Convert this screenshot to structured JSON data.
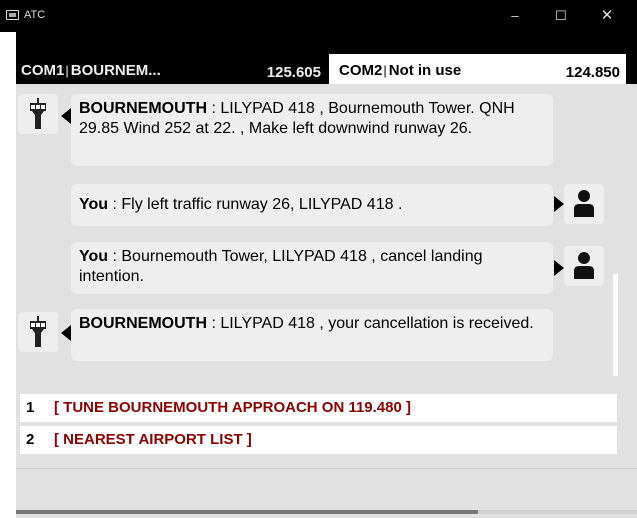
{
  "window": {
    "title": "ATC",
    "minimize_glyph": "–",
    "maximize_glyph": "☐",
    "close_glyph": "✕"
  },
  "radios": {
    "com1": {
      "label": "COM1",
      "station": "BOURNEM...",
      "frequency": "125.605"
    },
    "com2": {
      "label": "COM2",
      "station": "Not in use",
      "frequency": "124.850"
    }
  },
  "messages": [
    {
      "speaker": "BOURNEMOUTH",
      "text": " : LILYPAD 418 , Bournemouth Tower. QNH 29.85 Wind 252 at 22. , Make left downwind runway 26.",
      "icon": "control-tower-icon"
    },
    {
      "speaker": "You",
      "text": " : Fly left traffic runway 26, LILYPAD 418 .",
      "icon": "pilot-person-icon"
    },
    {
      "speaker": "You",
      "text": " : Bournemouth Tower, LILYPAD 418 , cancel landing intention.",
      "icon": "pilot-person-icon"
    },
    {
      "speaker": "BOURNEMOUTH",
      "text": " : LILYPAD 418 , your cancellation is received.",
      "icon": "control-tower-icon"
    }
  ],
  "choices": [
    {
      "number": "1",
      "text": "[ TUNE BOURNEMOUTH APPROACH ON 119.480 ]"
    },
    {
      "number": "2",
      "text": "[ NEAREST AIRPORT LIST ]"
    }
  ],
  "colors": {
    "choice_text": "#8b0000",
    "panel_background": "#e1e1e1",
    "bubble_background": "#eeeeee"
  }
}
